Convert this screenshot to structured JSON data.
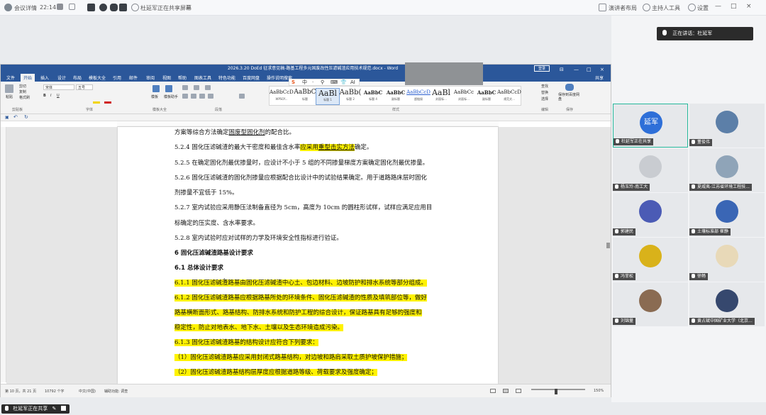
{
  "meeting_bar": {
    "app_name": "会议详情",
    "duration": "22:14",
    "sharing_status": "杜延军正在共享屏幕",
    "sharing_suffix": "☰",
    "layout_label": "演讲者布局",
    "host_tools": "主持人工具",
    "settings": "设置",
    "window_controls": [
      "—",
      "□",
      "×"
    ]
  },
  "word": {
    "title": "2026.3.20 DoEd 征求意见稿-路基工程多元固废改性压滤碱渣应用技术规范.docx - Word",
    "login": "登录",
    "share": "共享",
    "tabs": [
      "文件",
      "开始",
      "插入",
      "设计",
      "布局",
      "模板大全",
      "引用",
      "邮件",
      "审阅",
      "视图",
      "帮助",
      "图表工具",
      "特色功能",
      "百度网盘",
      "操作说明搜索"
    ],
    "active_tab": "开始",
    "font_name": "宋体",
    "font_size": "五号",
    "groups": {
      "clipboard": "剪贴板",
      "font": "字体",
      "templates": "模板大全",
      "paragraph": "段落",
      "styles": "样式",
      "editing": "编辑",
      "save": "保存"
    },
    "buttons": {
      "paste": "粘贴",
      "cut": "剪切",
      "copy": "复制",
      "format_painter": "格式刷",
      "template": "模板",
      "template_help": "模板助手",
      "find": "查找",
      "replace": "替换",
      "select": "选择",
      "save_baidu": "保存到百度网盘"
    },
    "styles": [
      {
        "sample": "AaBbCcDc",
        "name": "WPSOf..."
      },
      {
        "sample": "AaBbC",
        "name": "标题"
      },
      {
        "sample": "AaBl",
        "name": "标题 1"
      },
      {
        "sample": "AaBb(",
        "name": "标题 2"
      },
      {
        "sample": "AaBbC",
        "name": "标题 4"
      },
      {
        "sample": "AaBbC",
        "name": "副标题"
      },
      {
        "sample": "AaBbCcD",
        "name": "超链接"
      },
      {
        "sample": "AaBl",
        "name": "封面标..."
      },
      {
        "sample": "AaBbCc",
        "name": "封面标..."
      },
      {
        "sample": "AaBbC",
        "name": "副标题"
      },
      {
        "sample": "AaBbCcD",
        "name": "规范文..."
      }
    ],
    "ime_bar": [
      "S",
      "中",
      "·",
      "⚲",
      "⌨",
      "👕",
      "AI"
    ],
    "document": {
      "lines": [
        {
          "segments": [
            {
              "text": "方案等综合方法确定"
            },
            {
              "text": "固废型固化剂",
              "style": "u"
            },
            {
              "text": "的配合比。"
            }
          ]
        },
        {
          "segments": [
            {
              "text": "5.2.4  固化压滤碱渣的最大干密度和最佳含水率"
            },
            {
              "text": "应采用",
              "style": "hl"
            },
            {
              "text": "重型击实方法",
              "style": "hlu"
            },
            {
              "text": "确定。"
            }
          ]
        },
        {
          "segments": [
            {
              "text": "5.2.5  在确定固化剂最优掺量时，应设计不小于 5 组的不同掺量梯度方案确定固化剂最优掺量。"
            }
          ]
        },
        {
          "segments": [
            {
              "text": "5.2.6  固化压滤碱渣的固化剂掺量应根据配合比设计中的试验结果确定。用于道路路床层时固化"
            }
          ]
        },
        {
          "segments": [
            {
              "text": "剂掺量不宜低于 15%。"
            }
          ]
        },
        {
          "segments": [
            {
              "text": "5.2.7  室内试验应采用静压法制备直径为 5cm，高度为 10cm 的圆柱形试样，试样应满足应用目"
            }
          ]
        },
        {
          "segments": [
            {
              "text": "标确定的压实度、含水率要求。"
            }
          ]
        },
        {
          "segments": [
            {
              "text": "5.2.8  室内试验时应对试样的力学及环境安全性指标进行验证。"
            }
          ]
        },
        {
          "segments": [
            {
              "text": "6    固化压滤碱渣路基设计要求",
              "style": "hd"
            }
          ]
        },
        {
          "segments": [
            {
              "text": "6.1  总体设计要求",
              "style": "hd"
            }
          ]
        },
        {
          "segments": [
            {
              "text": "6.1.1  固化压滤碱渣路基由固化压滤碱渣中心土、包边材料、边坡防护和排水系统等部分组成。",
              "style": "hl"
            }
          ]
        },
        {
          "segments": [
            {
              "text": "6.1.2  固化压滤碱渣路基应根据路基所处的环境条件、固化压滤碱渣的性质及填筑部位等，做好",
              "style": "hl"
            }
          ]
        },
        {
          "segments": [
            {
              "text": "路基横断面形式、路基结构、防排水系统和防护工程的综合设计，保证路基具有足够的强度和",
              "style": "hl"
            }
          ]
        },
        {
          "segments": [
            {
              "text": "稳定性，防止对地表水、地下水、土壤以及生态环境造成污染。",
              "style": "hl"
            }
          ]
        },
        {
          "segments": [
            {
              "text": "6.1.3  固化压滤碱渣路基的结构设计应符合下列要求：",
              "style": "hl"
            }
          ]
        },
        {
          "segments": [
            {
              "text": "（1）固化压滤碱渣路基应采用封闭式路基结构，对边坡和路肩采取土质护坡保护措施；",
              "style": "hl"
            }
          ]
        },
        {
          "segments": [
            {
              "text": "（2）固化压滤碱渣路基结构层厚度应根据道路等级、荷载要求及强度确定；",
              "style": "hl"
            }
          ]
        }
      ]
    },
    "status": {
      "page": "第 10 页，共 21 页",
      "words": "10792 个字",
      "lang": "中文(中国)",
      "accessibility": "辅助功能: 调查",
      "zoom": "150%",
      "zoom_value": 150
    }
  },
  "speaking": "正在讲话：杜延军",
  "participants": [
    {
      "name": "杜延军正在共享",
      "avatar_text": "延军",
      "color": "#2e6fd8",
      "active": true
    },
    {
      "name": "董俊伟",
      "avatar_text": "",
      "color": "#5c7fa8",
      "active": false
    },
    {
      "name": "杨玉玲-南工大",
      "avatar_text": "",
      "color": "#c9ccd1",
      "active": false
    },
    {
      "name": "夏威夷-江苏省环境工程技...",
      "avatar_text": "",
      "color": "#8fa4b8",
      "active": false
    },
    {
      "name": "郭建民",
      "avatar_text": "",
      "color": "#4b5bb5",
      "active": false
    },
    {
      "name": "土壤标准部 崔静",
      "avatar_text": "",
      "color": "#3a66b5",
      "active": false
    },
    {
      "name": "冯菲松",
      "avatar_text": "",
      "color": "#d9b21a",
      "active": false
    },
    {
      "name": "徐畅",
      "avatar_text": "",
      "color": "#e8d9b8",
      "active": false
    },
    {
      "name": "刘锦量",
      "avatar_text": "",
      "color": "#8a6b52",
      "active": false
    },
    {
      "name": "黄占斌中国矿业大学（北京...",
      "avatar_text": "",
      "color": "#36486e",
      "active": false
    }
  ],
  "bottom": {
    "share_tag": "杜延军正在共享"
  }
}
